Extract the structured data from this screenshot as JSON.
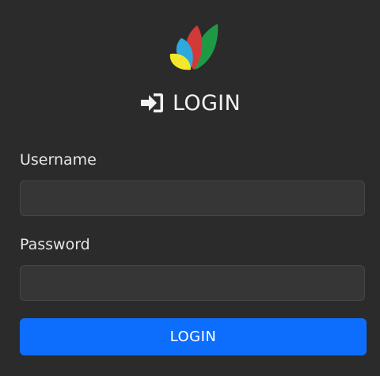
{
  "header": {
    "logo_icon": "leaf-petals-logo",
    "title_icon": "sign-in-icon",
    "title": "LOGIN"
  },
  "form": {
    "username_label": "Username",
    "username_value": "",
    "password_label": "Password",
    "password_value": "",
    "submit_label": "LOGIN"
  },
  "colors": {
    "background": "#2b2b2b",
    "input_background": "#363636",
    "button": "#0d6efd",
    "logo_green": "#1e9a46",
    "logo_red": "#d23a3a",
    "logo_blue": "#2ea9de",
    "logo_yellow": "#f4e72a"
  }
}
